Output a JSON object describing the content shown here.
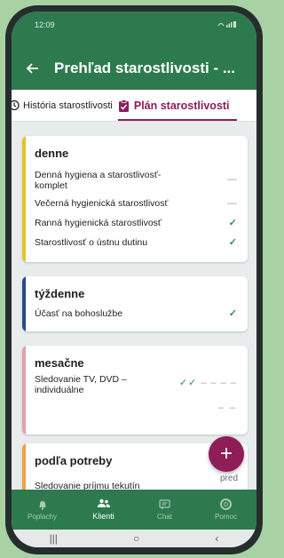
{
  "status": {
    "time": "12:09"
  },
  "appbar": {
    "title": "Prehľad starostlivosti - ..."
  },
  "tabs": [
    {
      "label": "História starostlivosti"
    },
    {
      "label": "Plán starostlivosti"
    }
  ],
  "colors": {
    "primary": "#2d7a4f",
    "accent": "#8e1d58",
    "check": "#2e8b4b"
  },
  "sections": [
    {
      "title": "denne",
      "stripe_color": "#e8c22a",
      "items": [
        {
          "label": "Denná hygiena a starostlivosť-komplet",
          "status": "—"
        },
        {
          "label": "Večerná hygienická starostlivosť",
          "status": "—"
        },
        {
          "label": "Ranná hygienická starostlivosť",
          "status": "✓"
        },
        {
          "label": "Starostlivosť o ústnu dutinu",
          "status": "✓"
        }
      ]
    },
    {
      "title": "týždenne",
      "stripe_color": "#2a4a8c",
      "items": [
        {
          "label": "Účasť na bohoslužbe",
          "status": "✓"
        }
      ]
    },
    {
      "title": "mesačne",
      "stripe_color": "#e3a0ad",
      "items": [
        {
          "label": "Sledovanie TV, DVD – individuálne",
          "checks": "✓✓",
          "dashes": "– – – –",
          "dashes2": "– –"
        }
      ]
    },
    {
      "title": "podľa potreby",
      "stripe_color": "#f0a14a",
      "items": [
        {
          "label": "Sledovanie príjmu tekutín"
        }
      ]
    }
  ],
  "fab": {
    "icon": "+",
    "label": "pred"
  },
  "bottom_nav": [
    {
      "label": "Poplachy",
      "icon": "bell-icon"
    },
    {
      "label": "Klienti",
      "icon": "people-icon"
    },
    {
      "label": "Chat",
      "icon": "chat-icon"
    },
    {
      "label": "Pomoc",
      "icon": "lifebuoy-icon"
    }
  ],
  "system_nav": {
    "recent": "|||",
    "home": "○",
    "back": "‹"
  }
}
